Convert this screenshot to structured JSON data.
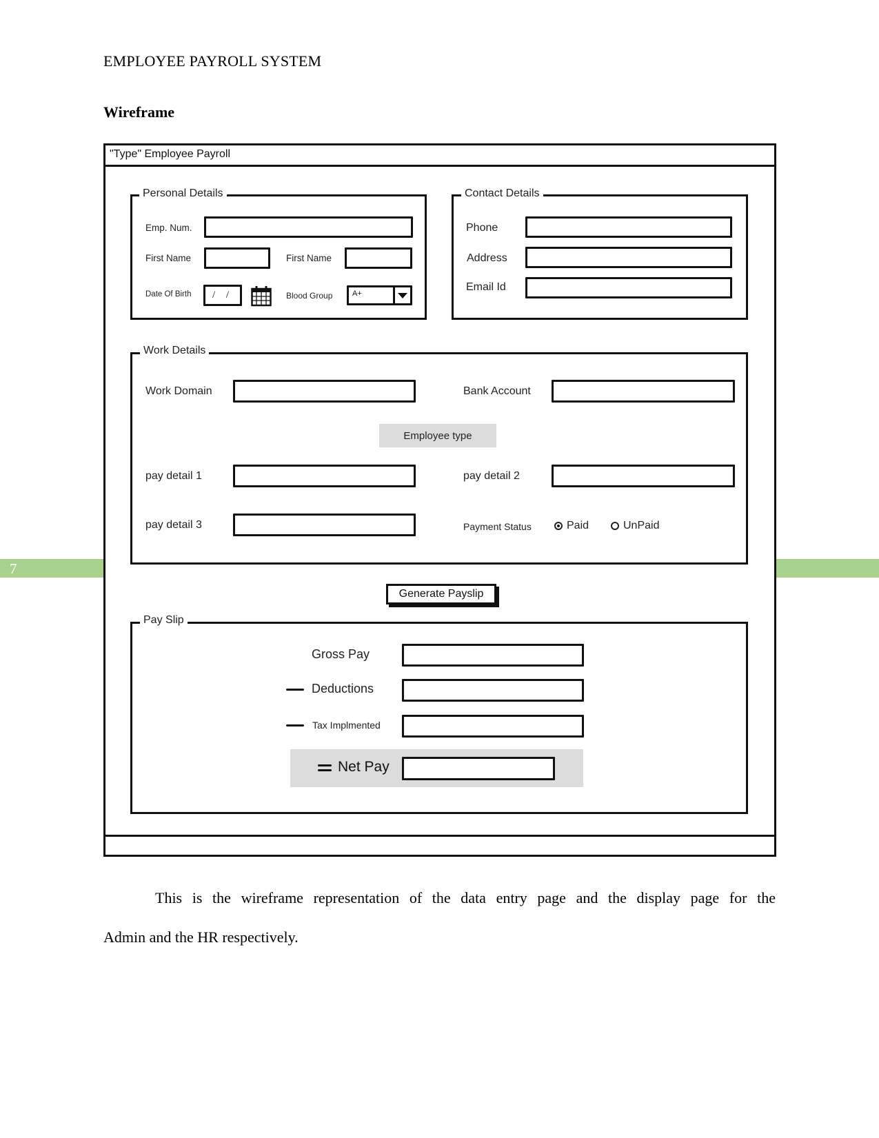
{
  "document": {
    "running_header": "EMPLOYEE PAYROLL SYSTEM",
    "section_heading": "Wireframe",
    "page_number": "7",
    "band_color": "#a9d18e",
    "paragraph_line1": "This is the wireframe representation of the data entry page and the display page for the",
    "paragraph_line2": "Admin and the HR respectively."
  },
  "wireframe": {
    "window_title": "\"Type\" Employee Payroll",
    "personal_details": {
      "legend": "Personal Details",
      "emp_num_label": "Emp. Num.",
      "first_name_label": "First Name",
      "first_name_label_2": "First Name",
      "dob_label": "Date Of Birth",
      "dob_value": "/ /",
      "calendar_icon": "calendar-icon",
      "blood_group_label": "Blood Group",
      "blood_group_value": "A+"
    },
    "contact_details": {
      "legend": "Contact Details",
      "phone_label": "Phone",
      "address_label": "Address",
      "email_label": "Email Id"
    },
    "work_details": {
      "legend": "Work Details",
      "work_domain_label": "Work Domain",
      "bank_account_label": "Bank Account",
      "employee_type_button": "Employee type",
      "pay_detail_1_label": "pay detail 1",
      "pay_detail_2_label": "pay detail 2",
      "pay_detail_3_label": "pay detail 3",
      "payment_status_label": "Payment Status",
      "payment_status_options": [
        "Paid",
        "UnPaid"
      ],
      "payment_status_selected": "Paid"
    },
    "generate_button": "Generate Payslip",
    "pay_slip": {
      "legend": "Pay Slip",
      "gross_pay_label": "Gross Pay",
      "deductions_label": "Deductions",
      "tax_label": "Tax Implmented",
      "net_pay_label": "Net Pay",
      "minus_sign": "minus-icon",
      "equals_sign": "equals-icon"
    }
  }
}
